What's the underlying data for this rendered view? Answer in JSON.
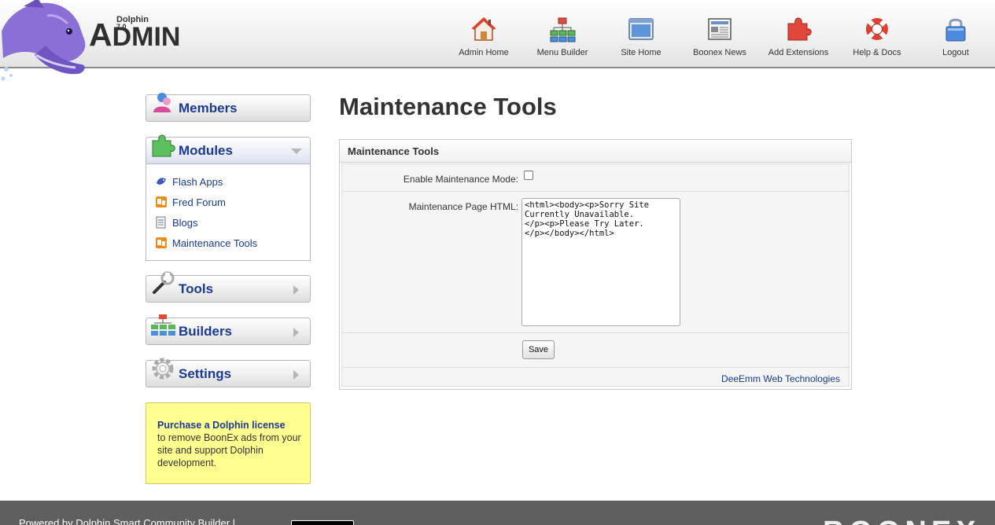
{
  "header": {
    "brand_small": "Dolphin",
    "brand_version": "7.0",
    "brand_admin_a": "A",
    "brand_admin_rest": "DMIN",
    "nav": [
      {
        "label": "Admin Home",
        "icon": "house-icon"
      },
      {
        "label": "Menu Builder",
        "icon": "sitemap-icon"
      },
      {
        "label": "Site Home",
        "icon": "browser-window-icon"
      },
      {
        "label": "Boonex News",
        "icon": "newspaper-icon"
      },
      {
        "label": "Add Extensions",
        "icon": "puzzle-piece-icon"
      },
      {
        "label": "Help & Docs",
        "icon": "lifebuoy-icon"
      },
      {
        "label": "Logout",
        "icon": "padlock-icon"
      }
    ]
  },
  "sidebar": {
    "members": "Members",
    "modules": "Modules",
    "module_items": [
      "Flash Apps",
      "Fred Forum",
      "Blogs",
      "Maintenance Tools"
    ],
    "tools": "Tools",
    "builders": "Builders",
    "settings": "Settings",
    "license_title": "Purchase a Dolphin license",
    "license_text": "to remove BoonEx ads from your site and support Dolphin development."
  },
  "main": {
    "page_title": "Maintenance Tools",
    "panel_title": "Maintenance Tools",
    "enable_label": "Enable Maintenance Mode:",
    "enable_checked": false,
    "html_label": "Maintenance Page HTML:",
    "html_value": "<html><body><p>Sorry Site\nCurrently Unavailable.\n</p><p>Please Try Later.\n</p></body></html>",
    "save_label": "Save",
    "credit": "DeeEmm Web Technologies"
  },
  "footer": {
    "text": "Powered by Dolphin Smart Community Builder |",
    "logo": "BOONEX"
  },
  "colors": {
    "link_blue": "#1a3a93",
    "license_bg": "#ffff90",
    "footer_bg": "#5f5f5f"
  }
}
